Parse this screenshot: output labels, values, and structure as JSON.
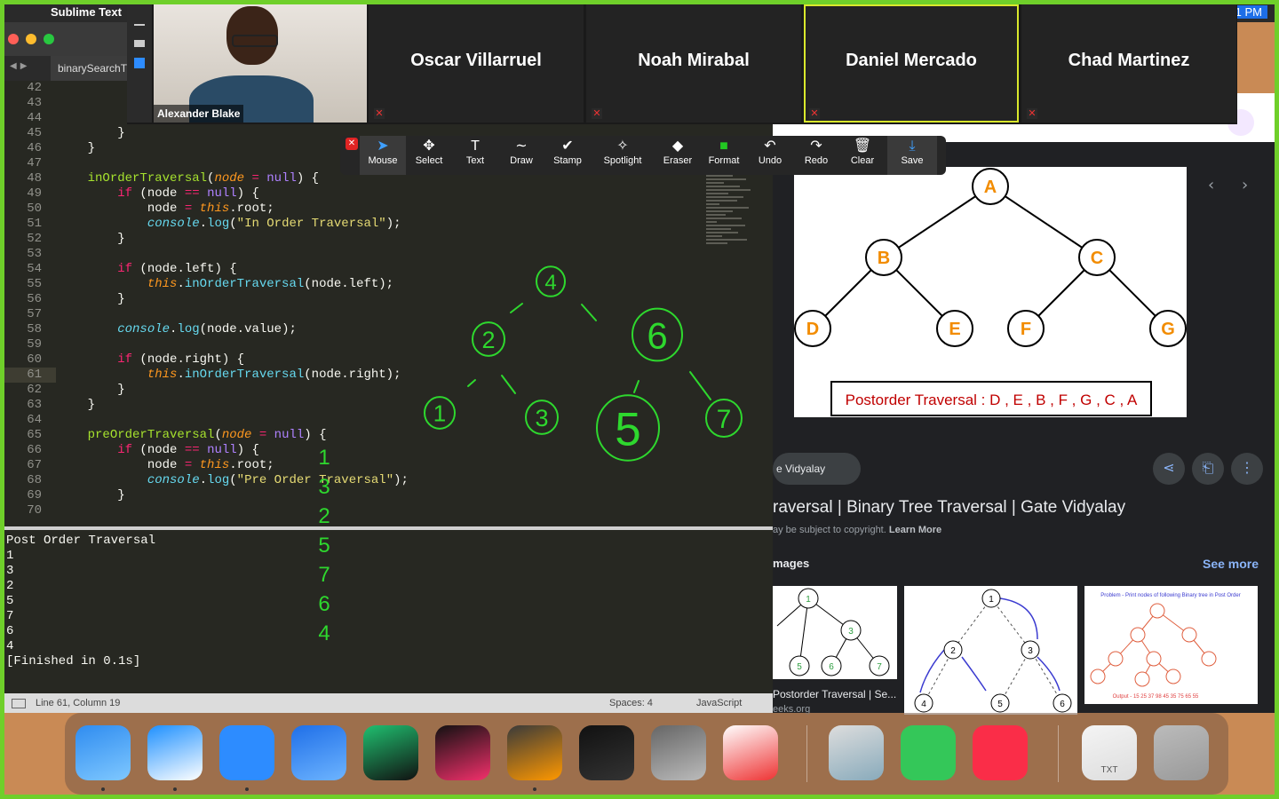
{
  "menubar": {
    "apple": "",
    "app_name": "Sublime Text",
    "clock": "1 PM"
  },
  "sublime": {
    "tab_label": "binarySearchT",
    "lines": [
      {
        "n": "42",
        "segs": []
      },
      {
        "n": "43",
        "segs": []
      },
      {
        "n": "44",
        "segs": []
      },
      {
        "n": "45",
        "segs": [
          {
            "t": "        }",
            "c": ""
          }
        ]
      },
      {
        "n": "46",
        "segs": [
          {
            "t": "    }",
            "c": ""
          }
        ]
      },
      {
        "n": "47",
        "segs": []
      },
      {
        "n": "48",
        "segs": [
          {
            "t": "    ",
            "c": ""
          },
          {
            "t": "inOrderTraversal",
            "c": "fn"
          },
          {
            "t": "(",
            "c": ""
          },
          {
            "t": "node",
            "c": "pa"
          },
          {
            "t": " = ",
            "c": "kw"
          },
          {
            "t": "null",
            "c": "nl"
          },
          {
            "t": ") {",
            "c": ""
          }
        ]
      },
      {
        "n": "49",
        "segs": [
          {
            "t": "        ",
            "c": ""
          },
          {
            "t": "if",
            "c": "kw"
          },
          {
            "t": " (node ",
            "c": ""
          },
          {
            "t": "==",
            "c": "kw"
          },
          {
            "t": " ",
            "c": ""
          },
          {
            "t": "null",
            "c": "nl"
          },
          {
            "t": ") {",
            "c": ""
          }
        ]
      },
      {
        "n": "50",
        "segs": [
          {
            "t": "            node ",
            "c": ""
          },
          {
            "t": "=",
            "c": "kw"
          },
          {
            "t": " ",
            "c": ""
          },
          {
            "t": "this",
            "c": "th"
          },
          {
            "t": ".root;",
            "c": ""
          }
        ]
      },
      {
        "n": "51",
        "segs": [
          {
            "t": "            ",
            "c": ""
          },
          {
            "t": "console",
            "c": "co"
          },
          {
            "t": ".",
            "c": ""
          },
          {
            "t": "log",
            "c": "pr"
          },
          {
            "t": "(",
            "c": ""
          },
          {
            "t": "\"In Order Traversal\"",
            "c": "st"
          },
          {
            "t": ");",
            "c": ""
          }
        ]
      },
      {
        "n": "52",
        "segs": [
          {
            "t": "        }",
            "c": ""
          }
        ]
      },
      {
        "n": "53",
        "segs": []
      },
      {
        "n": "54",
        "segs": [
          {
            "t": "        ",
            "c": ""
          },
          {
            "t": "if",
            "c": "kw"
          },
          {
            "t": " (node.left) {",
            "c": ""
          }
        ]
      },
      {
        "n": "55",
        "segs": [
          {
            "t": "            ",
            "c": ""
          },
          {
            "t": "this",
            "c": "th"
          },
          {
            "t": ".",
            "c": ""
          },
          {
            "t": "inOrderTraversal",
            "c": "pr"
          },
          {
            "t": "(node.left);",
            "c": ""
          }
        ]
      },
      {
        "n": "56",
        "segs": [
          {
            "t": "        }",
            "c": ""
          }
        ]
      },
      {
        "n": "57",
        "segs": []
      },
      {
        "n": "58",
        "segs": [
          {
            "t": "        ",
            "c": ""
          },
          {
            "t": "console",
            "c": "co"
          },
          {
            "t": ".",
            "c": ""
          },
          {
            "t": "log",
            "c": "pr"
          },
          {
            "t": "(node.value);",
            "c": ""
          }
        ]
      },
      {
        "n": "59",
        "segs": []
      },
      {
        "n": "60",
        "segs": [
          {
            "t": "        ",
            "c": ""
          },
          {
            "t": "if",
            "c": "kw"
          },
          {
            "t": " (node.right) {",
            "c": ""
          }
        ]
      },
      {
        "n": "61",
        "segs": [
          {
            "t": "            ",
            "c": ""
          },
          {
            "t": "this",
            "c": "th"
          },
          {
            "t": ".",
            "c": ""
          },
          {
            "t": "inOrderTraversal",
            "c": "pr"
          },
          {
            "t": "(node.right);",
            "c": ""
          }
        ]
      },
      {
        "n": "62",
        "segs": [
          {
            "t": "        }",
            "c": ""
          }
        ]
      },
      {
        "n": "63",
        "segs": [
          {
            "t": "    }",
            "c": ""
          }
        ]
      },
      {
        "n": "64",
        "segs": []
      },
      {
        "n": "65",
        "segs": [
          {
            "t": "    ",
            "c": ""
          },
          {
            "t": "preOrderTraversal",
            "c": "fn"
          },
          {
            "t": "(",
            "c": ""
          },
          {
            "t": "node",
            "c": "pa"
          },
          {
            "t": " = ",
            "c": "kw"
          },
          {
            "t": "null",
            "c": "nl"
          },
          {
            "t": ") {",
            "c": ""
          }
        ]
      },
      {
        "n": "66",
        "segs": [
          {
            "t": "        ",
            "c": ""
          },
          {
            "t": "if",
            "c": "kw"
          },
          {
            "t": " (node ",
            "c": ""
          },
          {
            "t": "==",
            "c": "kw"
          },
          {
            "t": " ",
            "c": ""
          },
          {
            "t": "null",
            "c": "nl"
          },
          {
            "t": ") {",
            "c": ""
          }
        ]
      },
      {
        "n": "67",
        "segs": [
          {
            "t": "            node ",
            "c": ""
          },
          {
            "t": "=",
            "c": "kw"
          },
          {
            "t": " ",
            "c": ""
          },
          {
            "t": "this",
            "c": "th"
          },
          {
            "t": ".root;",
            "c": ""
          }
        ]
      },
      {
        "n": "68",
        "segs": [
          {
            "t": "            ",
            "c": ""
          },
          {
            "t": "console",
            "c": "co"
          },
          {
            "t": ".",
            "c": ""
          },
          {
            "t": "log",
            "c": "pr"
          },
          {
            "t": "(",
            "c": ""
          },
          {
            "t": "\"Pre Order Traversal\"",
            "c": "st"
          },
          {
            "t": ");",
            "c": ""
          }
        ]
      },
      {
        "n": "69",
        "segs": [
          {
            "t": "        }",
            "c": ""
          }
        ]
      },
      {
        "n": "70",
        "segs": []
      }
    ],
    "highlight_line": "61",
    "output": [
      "Post Order Traversal",
      "1",
      "3",
      "2",
      "5",
      "7",
      "6",
      "4",
      "[Finished in 0.1s]"
    ],
    "status": {
      "position": "Line 61, Column 19",
      "spaces": "Spaces: 4",
      "syntax": "JavaScript"
    }
  },
  "zoom": {
    "self_name": "Alexander Blake",
    "participants": [
      "Oscar Villarruel",
      "Noah Mirabal",
      "Daniel Mercado",
      "Chad Martinez"
    ]
  },
  "annotate": {
    "tools": [
      {
        "label": "Mouse",
        "icon": "cursor-icon",
        "glyph": "➤"
      },
      {
        "label": "Select",
        "icon": "move-icon",
        "glyph": "✥"
      },
      {
        "label": "Text",
        "icon": "text-icon",
        "glyph": "T"
      },
      {
        "label": "Draw",
        "icon": "draw-icon",
        "glyph": "∼"
      },
      {
        "label": "Stamp",
        "icon": "stamp-icon",
        "glyph": "✔"
      },
      {
        "label": "Spotlight",
        "icon": "spotlight-icon",
        "glyph": "✧"
      },
      {
        "label": "Eraser",
        "icon": "eraser-icon",
        "glyph": "◆"
      },
      {
        "label": "Format",
        "icon": "format-icon",
        "glyph": "■"
      },
      {
        "label": "Undo",
        "icon": "undo-icon",
        "glyph": "↶"
      },
      {
        "label": "Redo",
        "icon": "redo-icon",
        "glyph": "↷"
      },
      {
        "label": "Clear",
        "icon": "trash-icon",
        "glyph": "🗑"
      },
      {
        "label": "Save",
        "icon": "save-icon",
        "glyph": "⤓"
      }
    ]
  },
  "handwriting": {
    "tree_nodes": [
      "4",
      "2",
      "6",
      "1",
      "3",
      "5",
      "7"
    ],
    "sequence": [
      "1",
      "3",
      "2",
      "5",
      "7",
      "6",
      "4"
    ]
  },
  "google": {
    "diagram_nodes": [
      "A",
      "B",
      "C",
      "D",
      "E",
      "F",
      "G"
    ],
    "diagram_caption": "Postorder Traversal : D , E , B , F , G , C , A",
    "source_chip": "e Vidyalay",
    "result_title": "raversal | Binary Tree Traversal | Gate Vidyalay",
    "copyright_prefix": "ay be subject to copyright. ",
    "learn_more": "Learn More",
    "related_label": "mages",
    "see_more": "See more",
    "thumb1_caption": "Postorder Traversal | Se...",
    "thumb1_source": "eeks.org",
    "thumb3_title": "Problem - Print nodes of following Binary tree in Post Order",
    "thumb3_output": "Output - 15 25 37 98 45 35 75 65 55"
  },
  "dock": {
    "apps": [
      "Finder",
      "Safari",
      "Zoom",
      "Xcode",
      "PyCharm",
      "IntelliJ IDEA",
      "Sublime Text",
      "Terminal",
      "Calculator",
      "Chrome",
      "Preview",
      "Messages",
      "Music",
      "TXT",
      "Trash"
    ]
  },
  "colors": {
    "accent_green": "#6fcf2a",
    "orange_node": "#f28c00",
    "caption_red": "#c00000",
    "link_blue": "#8ab4f8"
  }
}
